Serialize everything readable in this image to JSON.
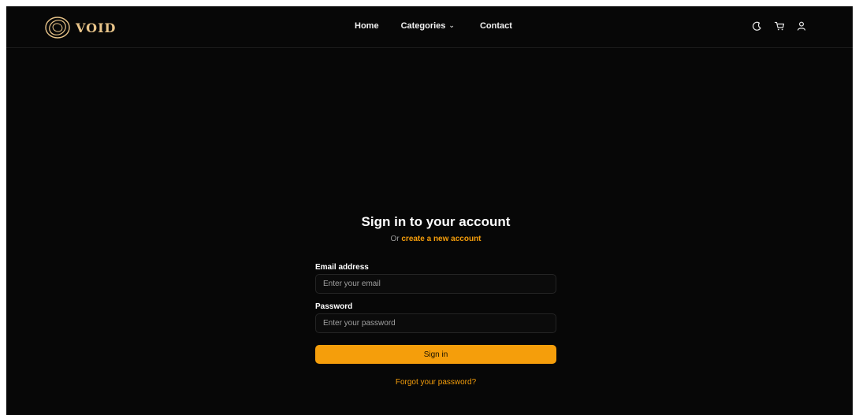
{
  "brand": {
    "name": "VOID",
    "accent_color": "#e8c489",
    "logo_icon": "rings-logo-icon"
  },
  "nav": {
    "links": [
      {
        "label": "Home"
      },
      {
        "label": "Categories",
        "icon": "chevron-down-icon"
      },
      {
        "label": "Contact"
      }
    ],
    "icons": [
      "moon-icon",
      "cart-icon",
      "user-icon"
    ]
  },
  "signin": {
    "title": "Sign in to your account",
    "subtitle_prefix": "Or ",
    "create_link": "create a new account",
    "email_label": "Email address",
    "email_placeholder": "Enter your email",
    "email_value": "",
    "password_label": "Password",
    "password_placeholder": "Enter your password",
    "password_value": "",
    "submit_label": "Sign in",
    "forgot_link": "Forgot your password?"
  },
  "colors": {
    "background": "#070707",
    "primary": "#f59e0b",
    "text": "#ffffff"
  }
}
